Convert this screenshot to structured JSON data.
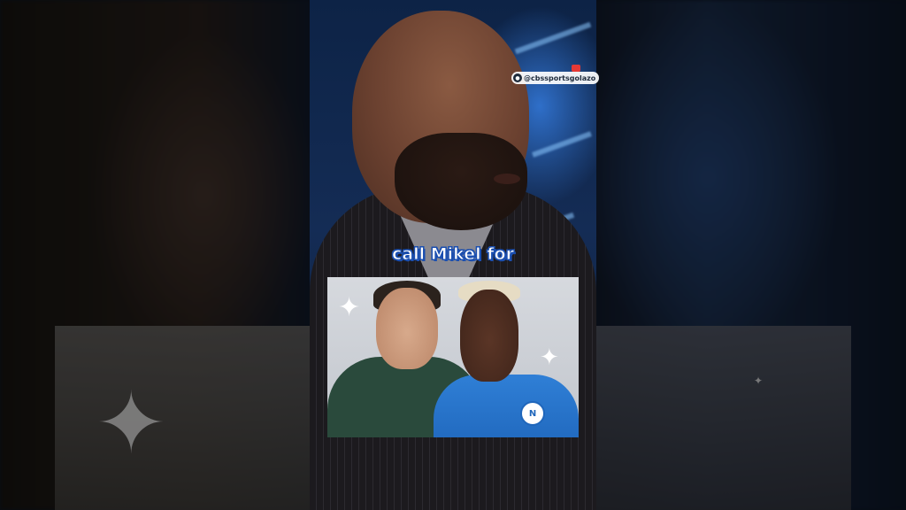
{
  "watermark": {
    "handle": "@cbssportsgolazo",
    "logo_icon": "cbs-eye-icon"
  },
  "caption": {
    "text": "call Mikel for"
  },
  "inset": {
    "crest_text": "N"
  },
  "colors": {
    "caption_outline": "#1b4fb0",
    "napoli_blue": "#1f66bb"
  }
}
